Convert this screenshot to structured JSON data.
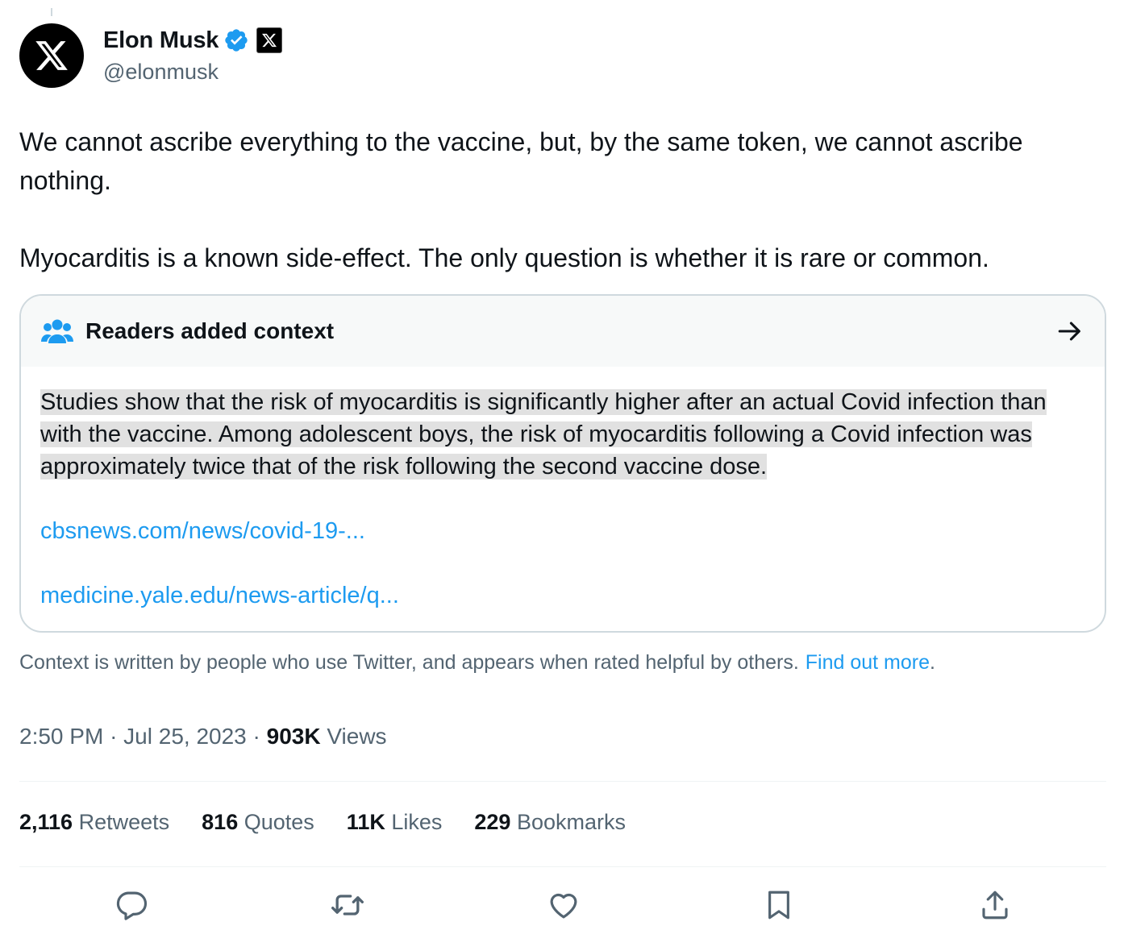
{
  "tweet": {
    "author": {
      "display_name": "Elon Musk",
      "handle": "@elonmusk"
    },
    "text": "We cannot ascribe everything to the vaccine, but, by the same token, we cannot ascribe nothing.\n\nMyocarditis is a known side-effect. The only question is whether it is rare or common.",
    "timestamp": {
      "time": "2:50 PM",
      "separator": "·",
      "date": "Jul 25, 2023"
    },
    "views": {
      "count": "903K",
      "label": "Views"
    }
  },
  "community_note": {
    "title": "Readers added context",
    "body": "Studies show that the risk of myocarditis is significantly higher after an actual Covid infection than with the vaccine. Among adolescent boys, the risk of myocarditis following a Covid infection was approximately twice that of the risk following the second vaccine dose.",
    "links": [
      "cbsnews.com/news/covid-19-...",
      "medicine.yale.edu/news-article/q..."
    ],
    "footer_text": "Context is written by people who use Twitter, and appears when rated helpful by others.",
    "footer_link": "Find out more",
    "footer_period": "."
  },
  "stats": [
    {
      "count": "2,116",
      "label": "Retweets"
    },
    {
      "count": "816",
      "label": "Quotes"
    },
    {
      "count": "11K",
      "label": "Likes"
    },
    {
      "count": "229",
      "label": "Bookmarks"
    }
  ],
  "colors": {
    "accent": "#1d9bf0",
    "text_primary": "#0f1419",
    "text_secondary": "#536471",
    "border": "#cfd9de",
    "note_header_bg": "#f7f9f9",
    "highlight": "#e1e1e1"
  },
  "icons": {
    "avatar": "x-logo-icon",
    "verified": "verified-badge-icon",
    "affiliate": "x-affiliate-badge-icon",
    "note": "people-icon",
    "note_open": "arrow-right-icon",
    "actions": [
      "reply-icon",
      "retweet-icon",
      "like-icon",
      "bookmark-icon",
      "share-icon"
    ]
  }
}
